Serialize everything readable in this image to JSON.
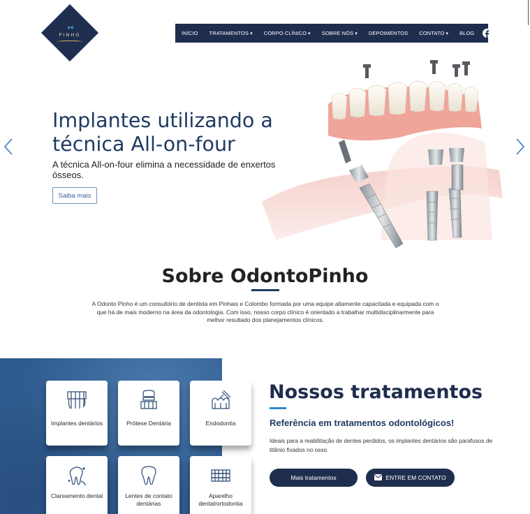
{
  "brand": {
    "logo_text": "PINHO"
  },
  "nav": {
    "items": [
      {
        "label": "INÍCIO"
      },
      {
        "label": "TRATAMENTOS"
      },
      {
        "label": "CORPO CLÍNICO"
      },
      {
        "label": "SOBRE NÓS"
      },
      {
        "label": "DEPOIMENTOS"
      },
      {
        "label": "CONTATO"
      },
      {
        "label": "BLOG"
      }
    ],
    "social_icons": [
      "facebook-icon",
      "instagram-icon"
    ]
  },
  "hero": {
    "title": "Implantes utilizando a técnica All-on-four",
    "subtitle": "A técnica All-on-four elimina a necessidade de enxertos ósseos.",
    "button": "Saiba mais"
  },
  "about": {
    "title": "Sobre OdontoPinho",
    "text": "A Odonto Pinho é um consultório de dentista em Pinhais e Colombo formada por uma equipe altamente capacitada e equipada com o que há de mais moderno na área da odontologia. Com isso, nosso corpo clínico é orientado a trabalhar multidisciplinarmente para melhor resultado dos planejamentos clínicos."
  },
  "treatments": {
    "title": "Nossos tratamentos",
    "subtitle": "Referência em tratamentos odontológicos!",
    "text": "Ideais para a reabilitação de dentes perdidos, os implantes dentários são parafusos de titânio fixados no osso.",
    "cards": [
      {
        "label": "Implantes dentários",
        "icon": "implant-icon"
      },
      {
        "label": "Prótese Dentária",
        "icon": "prosthesis-icon"
      },
      {
        "label": "Endodontia",
        "icon": "endodontics-icon"
      },
      {
        "label": "Clareamento dental",
        "icon": "whitening-icon"
      },
      {
        "label": "Lentes de contato dentárias",
        "icon": "tooth-icon"
      },
      {
        "label": "Aparelho dental/ortodontia",
        "icon": "braces-icon"
      }
    ],
    "btn_more": "Mais tratamentos",
    "btn_contact": "ENTRE EM CONTATO"
  },
  "colors": {
    "navy": "#1f2d4e",
    "accent_blue": "#2c8ad0",
    "panel_blue": "#2f5b8e"
  }
}
